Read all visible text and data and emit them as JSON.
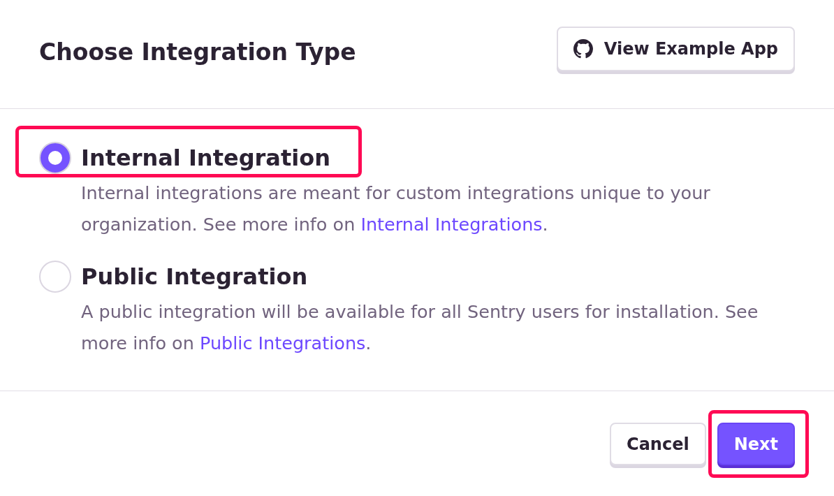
{
  "dialog": {
    "title": "Choose Integration Type",
    "header_button": {
      "label": "View Example App"
    }
  },
  "options": [
    {
      "label": "Internal Integration",
      "selected": true,
      "highlighted": true,
      "description": "Internal integrations are meant for custom integrations unique to your organization. See more info on ",
      "link": "Internal Integrations",
      "description_end": "."
    },
    {
      "label": "Public Integration",
      "selected": false,
      "highlighted": false,
      "description": "A public integration will be available for all Sentry users for installation. See more info on ",
      "link": "Public Integrations",
      "description_end": "."
    }
  ],
  "footer_buttons": [
    {
      "label": "Cancel",
      "kind": "secondary",
      "highlighted": false
    },
    {
      "label": "Next",
      "kind": "primary",
      "highlighted": true
    }
  ]
}
